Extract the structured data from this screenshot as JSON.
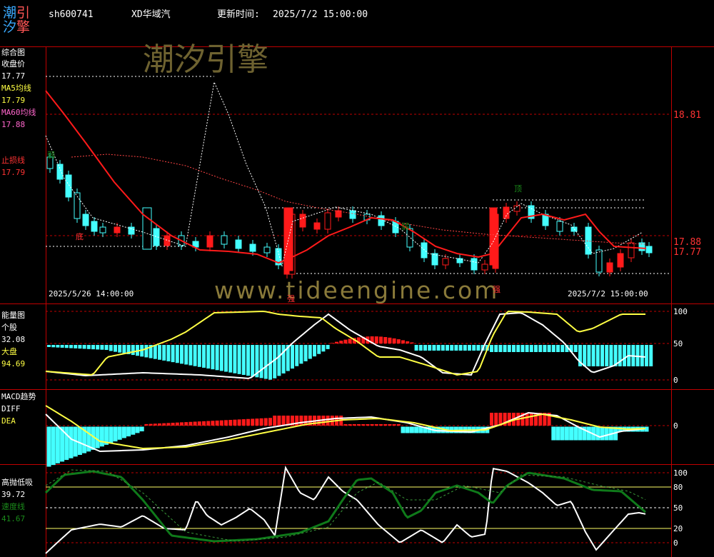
{
  "logo": {
    "c1": "潮",
    "c2": "引",
    "c3": "汐",
    "c4": "擎"
  },
  "header": {
    "symbol": "sh600741",
    "name": "XD华域汽",
    "update_label": "更新时间:",
    "update_time": "2025/7/2 15:00:00"
  },
  "watermark": {
    "cn": "潮汐引擎",
    "url": "www.tideengine.com"
  },
  "panel1": {
    "title": "综合图",
    "close_label": "收盘价",
    "close_value": "17.77",
    "ma5_label": "MA5均线",
    "ma5_value": "17.79",
    "ma60_label": "MA60均线",
    "ma60_value": "17.88",
    "stop_label": "止损线",
    "stop_value": "17.79",
    "axis": [
      "18.81",
      "17.88",
      "17.77"
    ],
    "date_start": "2025/5/26 14:00:00",
    "date_end": "2025/7/2 15:00:00",
    "marks": {
      "top": "顶",
      "bottom": "底",
      "strong1": "强",
      "strong2": "强",
      "weak": "弱",
      "weak2": "弱"
    }
  },
  "panel2": {
    "title": "能量图",
    "stock_label": "个股",
    "stock_value": "32.08",
    "market_label": "大盘",
    "market_value": "94.69",
    "axis": [
      "100",
      "50",
      "0"
    ]
  },
  "panel3": {
    "title": "MACD趋势",
    "diff_label": "DIFF",
    "dea_label": "DEA",
    "axis": [
      "0"
    ]
  },
  "panel4": {
    "title": "高抛低吸",
    "value1": "39.72",
    "speed_label": "速度线",
    "speed_value": "41.67",
    "axis": [
      "100",
      "80",
      "50",
      "20",
      "0"
    ]
  },
  "colors": {
    "red": "#ff2a2a",
    "cyan": "#4ff",
    "yellow": "#ff4",
    "green": "#0a7a14",
    "grid": "#c00000"
  }
}
